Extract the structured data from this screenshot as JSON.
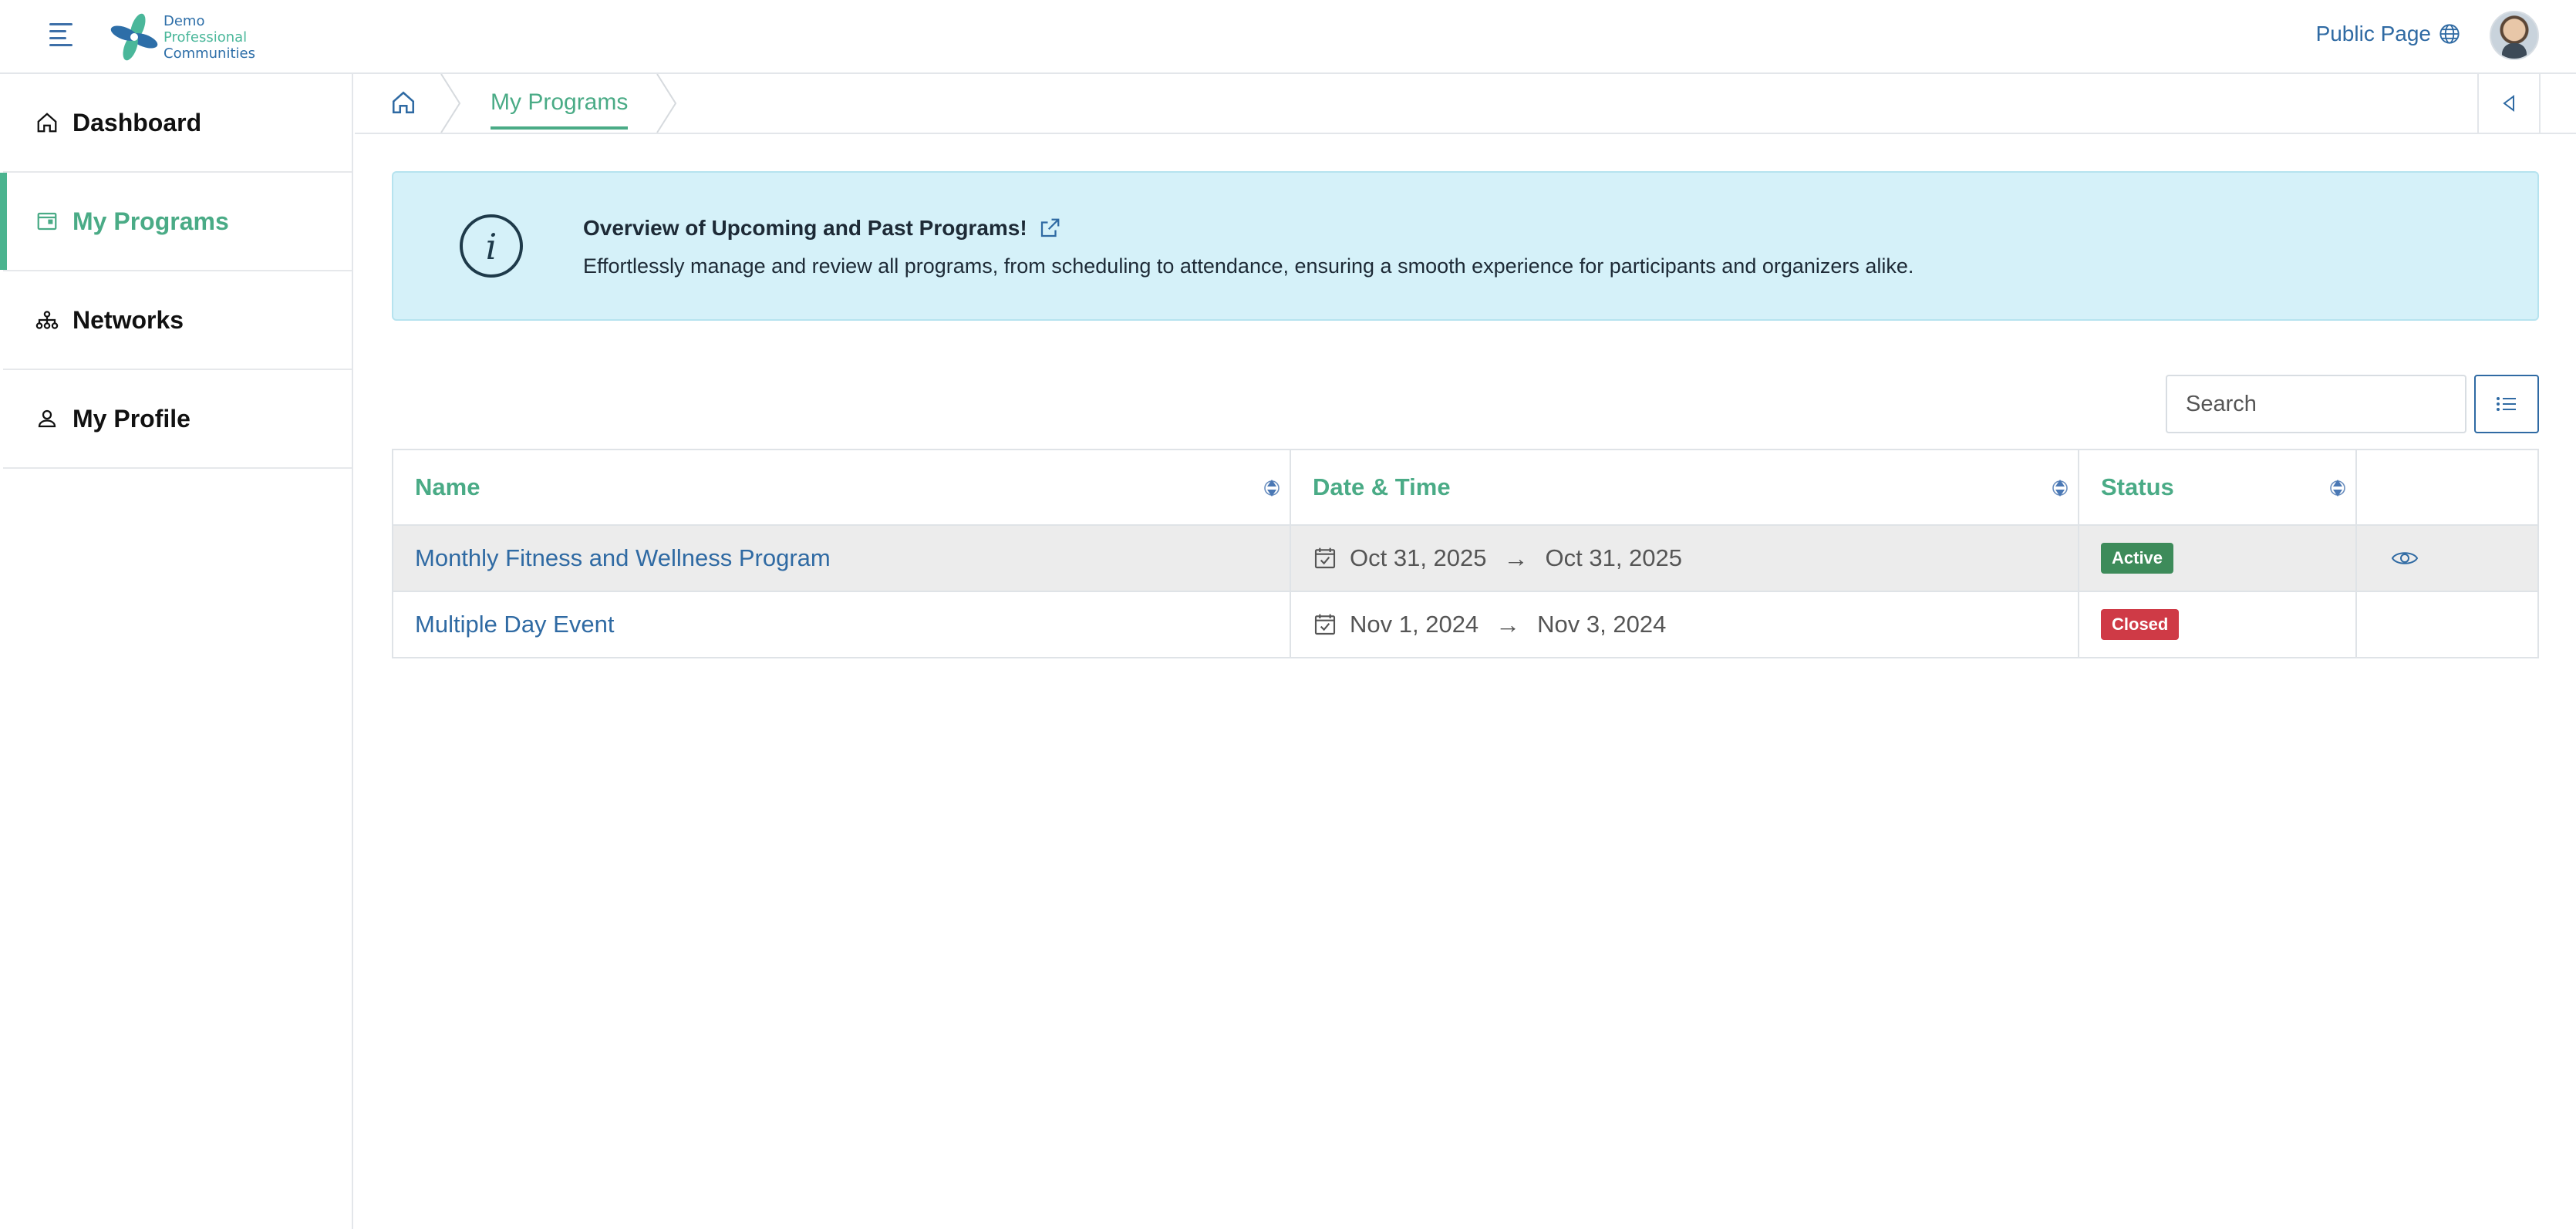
{
  "header": {
    "logo_lines": [
      "Demo",
      "Professional",
      "Communities"
    ],
    "public_page_label": "Public Page"
  },
  "sidebar": {
    "items": [
      {
        "label": "Dashboard",
        "icon": "home-icon",
        "active": false
      },
      {
        "label": "My Programs",
        "icon": "calendar-icon",
        "active": true
      },
      {
        "label": "Networks",
        "icon": "network-icon",
        "active": false
      },
      {
        "label": "My Profile",
        "icon": "user-icon",
        "active": false
      }
    ]
  },
  "breadcrumb": {
    "current": "My Programs"
  },
  "banner": {
    "title": "Overview of Upcoming and Past Programs!",
    "text": "Effortlessly manage and review all programs, from scheduling to attendance, ensuring a smooth experience for participants and organizers alike."
  },
  "search": {
    "placeholder": "Search"
  },
  "table": {
    "columns": [
      "Name",
      "Date & Time",
      "Status",
      ""
    ],
    "rows": [
      {
        "name": "Monthly Fitness and Wellness Program",
        "start": "Oct 31, 2025",
        "end": "Oct 31, 2025",
        "status": "Active",
        "has_view": true
      },
      {
        "name": "Multiple Day Event",
        "start": "Nov 1, 2024",
        "end": "Nov 3, 2024",
        "status": "Closed",
        "has_view": false
      }
    ]
  },
  "colors": {
    "accent_green": "#4aab86",
    "link_blue": "#2f6aa3",
    "active_badge": "#3d8b5a",
    "closed_badge": "#cf3a46",
    "banner_bg": "#d5f1f9"
  }
}
